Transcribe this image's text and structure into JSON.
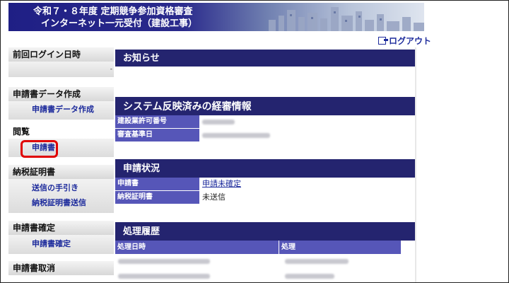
{
  "header": {
    "line1": "令和７・８年度 定期競争参加資格審査",
    "line2": "インターネット一元受付（建設工事）"
  },
  "logout": {
    "label": "ログアウト",
    "icon": "logout-icon"
  },
  "sidebar": {
    "last_login": {
      "heading": "前回ログイン日時",
      "value": "-"
    },
    "create": {
      "heading": "申請書データ作成",
      "items": [
        "申請書データ作成"
      ]
    },
    "view": {
      "heading": "閲覧",
      "items": [
        "申請書"
      ]
    },
    "tax": {
      "heading": "納税証明書",
      "items": [
        "送信の手引き",
        "納税証明書送信"
      ]
    },
    "confirm": {
      "heading": "申請書確定",
      "items": [
        "申請書確定"
      ]
    },
    "cancel": {
      "heading": "申請書取消"
    }
  },
  "main": {
    "notice": {
      "title": "お知らせ"
    },
    "keishin": {
      "title": "システム反映済みの経審情報",
      "rows": [
        {
          "label": "建設業許可番号",
          "value": ""
        },
        {
          "label": "審査基準日",
          "value": ""
        }
      ]
    },
    "status": {
      "title": "申請状況",
      "rows": [
        {
          "label": "申請書",
          "value": "申請未確定",
          "link": true
        },
        {
          "label": "納税証明書",
          "value": "未送信",
          "link": false
        }
      ]
    },
    "history": {
      "title": "処理履歴",
      "columns": [
        "処理日時",
        "処理"
      ]
    }
  },
  "colors": {
    "header_bar": "#24246f",
    "label_cell": "#5656b8",
    "link": "#1d2b9c",
    "highlight": "#e00000"
  }
}
